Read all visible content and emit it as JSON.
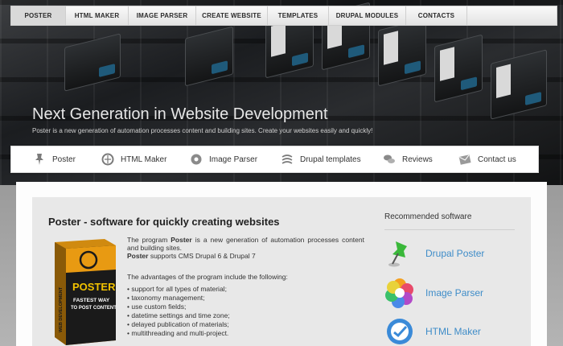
{
  "top_nav": {
    "tabs": [
      {
        "label": "POSTER",
        "active": true
      },
      {
        "label": "HTML MAKER",
        "active": false
      },
      {
        "label": "IMAGE PARSER",
        "active": false
      },
      {
        "label": "CREATE WEBSITE",
        "active": false
      },
      {
        "label": "TEMPLATES",
        "active": false
      },
      {
        "label": "DRUPAL MODULES",
        "active": false
      },
      {
        "label": "CONTACTS",
        "active": false
      }
    ]
  },
  "hero": {
    "title": "Next Generation in Website Development",
    "subtitle": "Poster is a new generation of automation processes content and building sites. Create your websites easily and quickly!"
  },
  "feature_bar": {
    "items": [
      {
        "label": "Poster",
        "icon": "pushpin-icon"
      },
      {
        "label": "HTML Maker",
        "icon": "html-icon"
      },
      {
        "label": "Image Parser",
        "icon": "image-icon"
      },
      {
        "label": "Drupal templates",
        "icon": "drupal-icon"
      },
      {
        "label": "Reviews",
        "icon": "speech-bubbles-icon"
      },
      {
        "label": "Contact us",
        "icon": "envelope-icon"
      }
    ]
  },
  "main": {
    "title": "Poster - software for quickly creating websites",
    "intro_1_a": "The program ",
    "intro_1_b": "Poster",
    "intro_1_c": " is a new generation of automation processes content and building sites.",
    "intro_2_a": "Poster",
    "intro_2_b": " supports CMS Drupal 6 & Drupal 7",
    "advantages_heading": "The advantages of the program include the following:",
    "advantages": [
      "support for all types of material;",
      "taxonomy management;",
      "use custom fields;",
      "datetime settings and time zone;",
      "delayed publication of materials;",
      "multithreading and multi-project."
    ],
    "box_art": {
      "title": "POSTER",
      "tagline_1": "FASTEST WAY",
      "tagline_2": "TO POST CONTENT",
      "side": "WEB DEVELOPMENT"
    }
  },
  "recommended": {
    "title": "Recommended software",
    "items": [
      {
        "label": "Drupal Poster",
        "icon": "green-pushpin-icon"
      },
      {
        "label": "Image Parser",
        "icon": "color-wheel-icon"
      },
      {
        "label": "HTML Maker",
        "icon": "html-globe-icon"
      }
    ]
  },
  "colors": {
    "link_blue": "#3e8cc8",
    "panel_gray": "#e8e8e8"
  }
}
